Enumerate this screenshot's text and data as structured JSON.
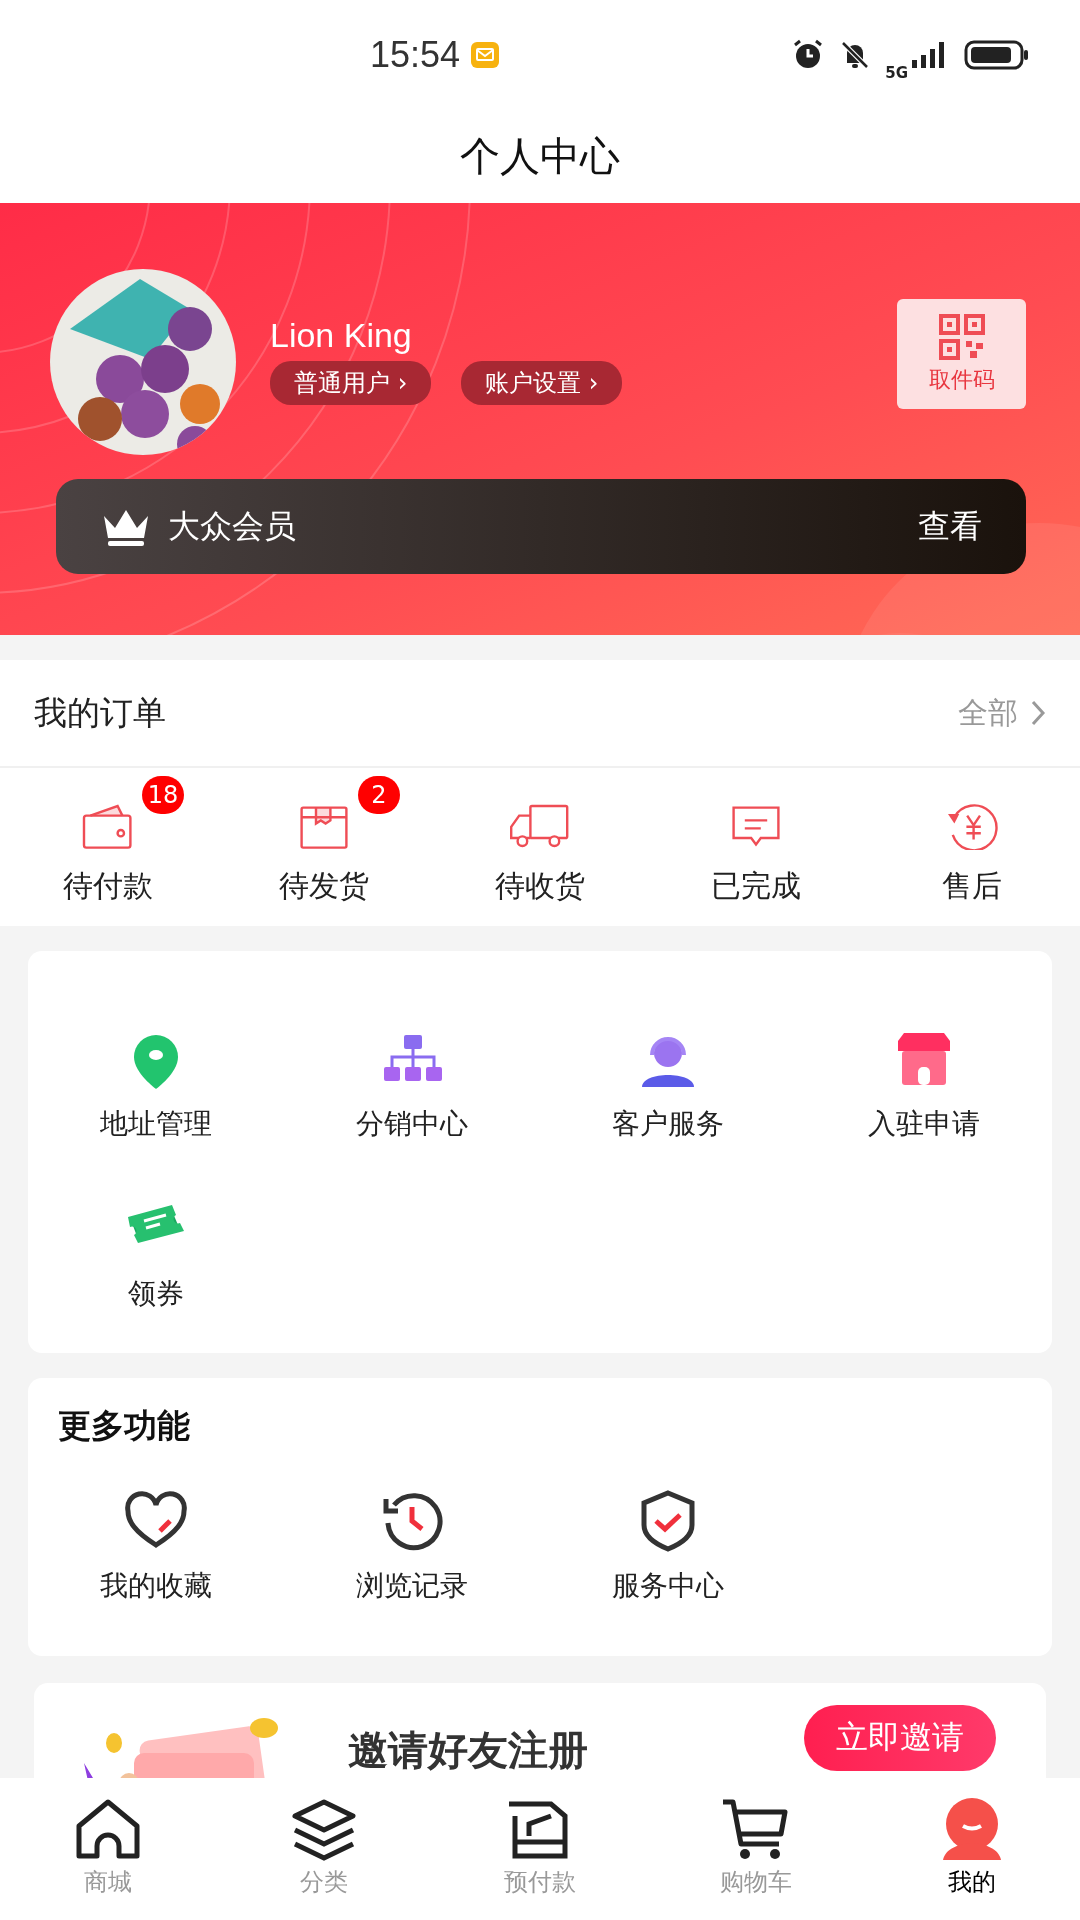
{
  "status_bar": {
    "time": "15:54",
    "network": "5G"
  },
  "title": "个人中心",
  "profile": {
    "name": "Lion King",
    "tags": [
      "普通用户 ›",
      "账户设置 ›"
    ],
    "pickup_label": "取件码",
    "membership": {
      "label": "大众会员",
      "action": "查看"
    }
  },
  "orders": {
    "title": "我的订单",
    "all_link": "全部",
    "items": [
      {
        "label": "待付款",
        "badge": "18"
      },
      {
        "label": "待发货",
        "badge": "2"
      },
      {
        "label": "待收货"
      },
      {
        "label": "已完成"
      },
      {
        "label": "售后"
      }
    ]
  },
  "services": [
    {
      "label": "地址管理"
    },
    {
      "label": "分销中心"
    },
    {
      "label": "客户服务"
    },
    {
      "label": "入驻申请"
    },
    {
      "label": "领券"
    }
  ],
  "more": {
    "title": "更多功能",
    "items": [
      {
        "label": "我的收藏"
      },
      {
        "label": "浏览记录"
      },
      {
        "label": "服务中心"
      }
    ]
  },
  "invite": {
    "title": "邀请好友注册",
    "button": "立即邀请"
  },
  "tab_bar": [
    {
      "label": "商城",
      "selected": false
    },
    {
      "label": "分类",
      "selected": false
    },
    {
      "label": "预付款",
      "selected": false
    },
    {
      "label": "购物车",
      "selected": false
    },
    {
      "label": "我的",
      "selected": true
    }
  ]
}
